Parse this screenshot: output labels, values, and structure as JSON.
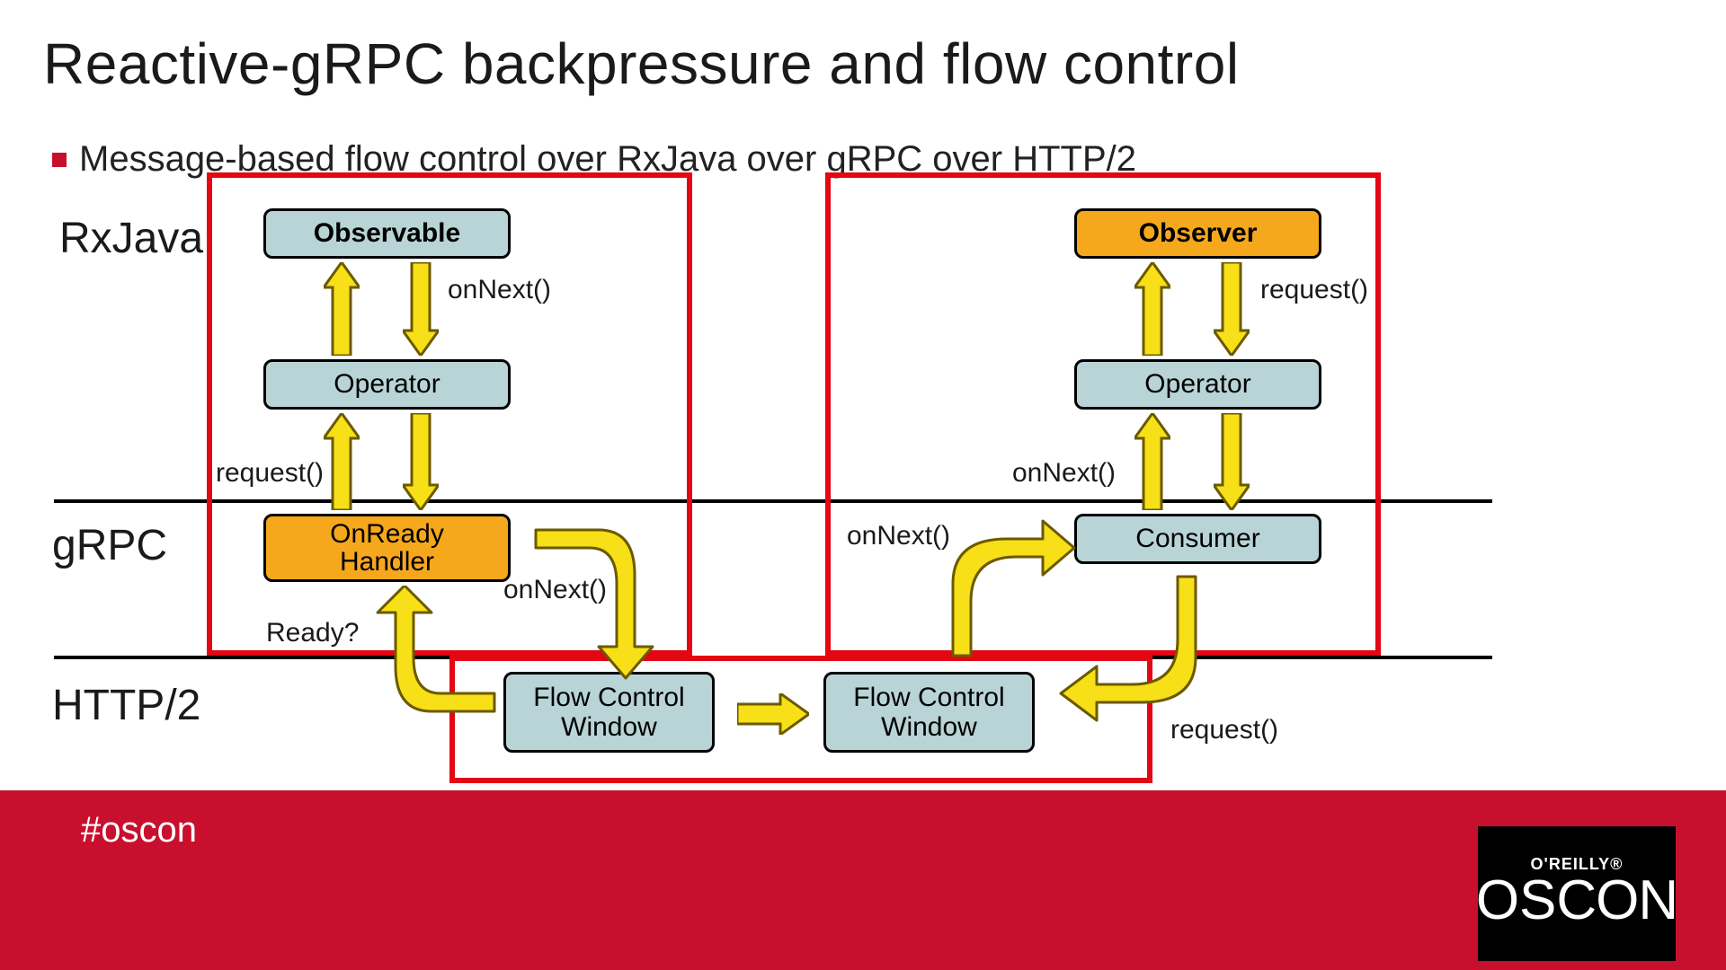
{
  "title": "Reactive-gRPC backpressure and flow control",
  "bullet": "Message-based flow control over RxJava over gRPC over HTTP/2",
  "layers": {
    "rxjava": "RxJava",
    "grpc": "gRPC",
    "http2": "HTTP/2"
  },
  "left": {
    "observable": "Observable",
    "operator": "Operator",
    "onready": "OnReady\nHandler",
    "onNext1": "onNext()",
    "request1": "request()",
    "onNext2": "onNext()",
    "ready": "Ready?"
  },
  "right": {
    "observer": "Observer",
    "operator": "Operator",
    "consumer": "Consumer",
    "request1": "request()",
    "onNext1": "onNext()",
    "onNext2": "onNext()",
    "request2": "request()"
  },
  "http2": {
    "fcw1": "Flow Control\nWindow",
    "fcw2": "Flow Control\nWindow"
  },
  "footer": {
    "hashtag": "#oscon",
    "publisher": "O'REILLY®",
    "brand": "OSCON"
  },
  "colors": {
    "red": "#e30613",
    "orange": "#f6a81c",
    "blue": "#b8d4d6",
    "yellow": "#f7e017",
    "footer": "#c8102e"
  }
}
